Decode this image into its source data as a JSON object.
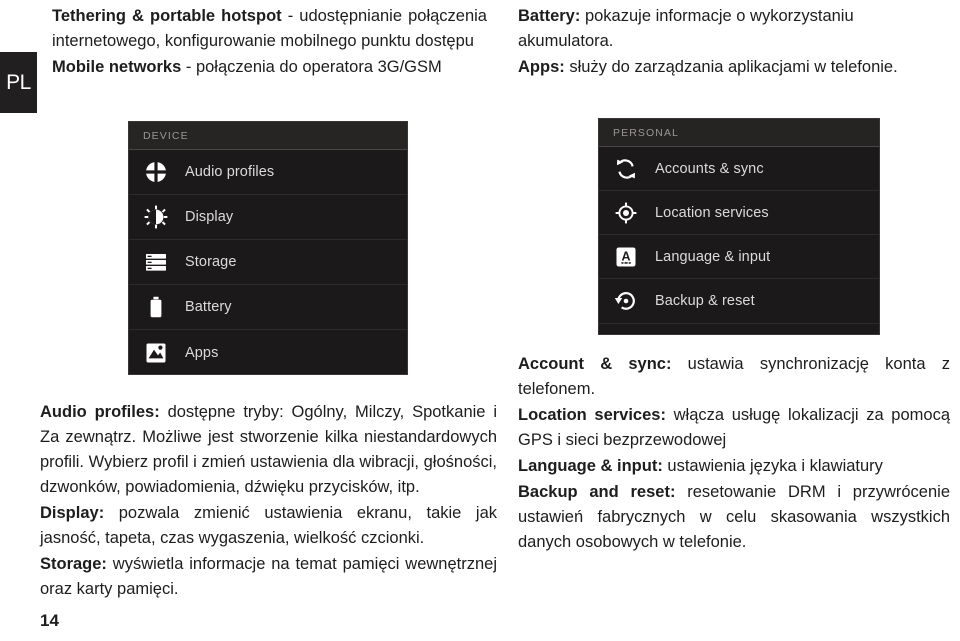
{
  "language_tab": {
    "label": "PL"
  },
  "top_left": {
    "paragraphs": [
      {
        "term": "Tethering & portable hotspot",
        "text": " - udostępnianie połączenia internetowego, konfigurowanie mobilnego punktu dostępu"
      },
      {
        "term": "Mobile networks",
        "text": " - połączenia do operatora 3G/GSM"
      }
    ]
  },
  "top_right": {
    "paragraphs": [
      {
        "term": "Battery:",
        "text": " pokazuje informacje o wykorzystaniu akumulatora."
      },
      {
        "term": "Apps:",
        "text": " służy do zarządzania aplikacjami w telefonie."
      }
    ]
  },
  "screenshot_device": {
    "header": "DEVICE",
    "items": [
      {
        "label": "Audio profiles",
        "icon": "audio-profiles-icon"
      },
      {
        "label": "Display",
        "icon": "display-brightness-icon"
      },
      {
        "label": "Storage",
        "icon": "storage-icon"
      },
      {
        "label": "Battery",
        "icon": "battery-icon"
      },
      {
        "label": "Apps",
        "icon": "apps-icon"
      }
    ]
  },
  "screenshot_personal": {
    "header": "PERSONAL",
    "items": [
      {
        "label": "Accounts & sync",
        "icon": "sync-icon"
      },
      {
        "label": "Location services",
        "icon": "location-crosshair-icon"
      },
      {
        "label": "Language & input",
        "icon": "language-a-icon"
      },
      {
        "label": "Backup & reset",
        "icon": "backup-reset-icon"
      }
    ]
  },
  "bottom_left": {
    "paragraphs": [
      {
        "term": "Audio profiles:",
        "text": " dostępne tryby: Ogólny, Milczy, Spotkanie i Za zewnątrz. Możliwe jest stworzenie kilka niestandardowych profili. Wybierz profil i zmień ustawienia dla wibracji, głośności, dzwonków, powiadomienia, dźwięku przycisków, itp."
      },
      {
        "term": "Display:",
        "text": " pozwala zmienić ustawienia ekranu, takie jak jasność, tapeta, czas wygaszenia, wielkość czcionki."
      },
      {
        "term": "Storage:",
        "text": " wyświetla informacje na temat pamięci wewnętrznej oraz karty pamięci."
      }
    ]
  },
  "bottom_right": {
    "paragraphs": [
      {
        "term": "Account & sync:",
        "text": " ustawia synchronizację konta z telefonem."
      },
      {
        "term": "Location services:",
        "text": " włącza usługę lokalizacji za pomocą GPS i sieci bezprzewodowej"
      },
      {
        "term": "Language & input:",
        "text": " ustawienia języka i klawiatury"
      },
      {
        "term": "Backup and reset:",
        "text": " resetowanie DRM i przywrócenie ustawień fabrycznych w celu skasowania wszystkich danych osobowych w telefonie."
      }
    ]
  },
  "page_number": "14",
  "colors": {
    "panel_bg": "#1b1919",
    "panel_header_bg": "#272424",
    "panel_text": "#dcdada",
    "tab_bg": "#211f1f",
    "body_text": "#1d1d1d"
  }
}
